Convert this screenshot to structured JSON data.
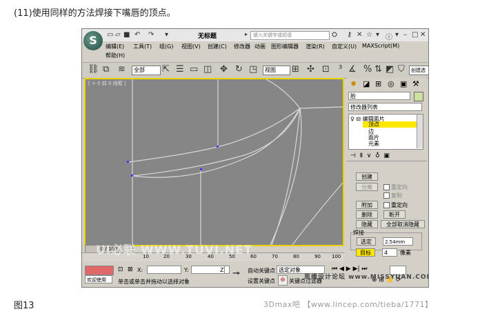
{
  "caption": "(11)使用同样的方法焊接下嘴唇的顶点。",
  "figure_label": "图13",
  "footer_credit": "3Dmax吧 【www.lincep.com/tieba/1771】",
  "app": {
    "logo": "S",
    "title": "无标题",
    "search_placeholder": "键入关键字或短语",
    "menus": [
      "编辑(E)",
      "工具(T)",
      "组(G)",
      "视图(V)",
      "创建(C)",
      "修改器",
      "动画",
      "图形编辑器",
      "渲染(R)",
      "自定义(U)",
      "MAXScript(M)",
      "帮助(H)"
    ],
    "toolbar": {
      "selection_filter": "全部",
      "ref_coord": "视图",
      "named_sel": "创建选"
    },
    "viewport_label": "[ + 0 前 0 线框 ]",
    "command_panel": {
      "object_name": "脸",
      "modifier_list": "修改器列表",
      "stack": [
        {
          "label": "编辑面片",
          "indent": 0,
          "selected": false
        },
        {
          "label": "顶点",
          "indent": 1,
          "selected": true
        },
        {
          "label": "边",
          "indent": 1,
          "selected": false
        },
        {
          "label": "面片",
          "indent": 1,
          "selected": false
        },
        {
          "label": "元素",
          "indent": 1,
          "selected": false
        }
      ],
      "buttons": {
        "create": "创建",
        "detach": "分离",
        "reorient": "重定向",
        "copy": "复制",
        "attach": "附加",
        "reorient2": "重定向",
        "delete": "删除",
        "break": "断开",
        "hide": "隐藏",
        "unhide_all": "全部取消隐藏"
      },
      "weld_group": {
        "title": "焊接",
        "selected_btn": "选定",
        "value": "2.54mm",
        "target_btn": "目标",
        "target_value": "4",
        "pixel_label": "像素"
      }
    },
    "timeline": {
      "frame": "0 / 100",
      "ticks": [
        "10",
        "20",
        "30",
        "40",
        "50",
        "60",
        "70",
        "80",
        "90",
        "100"
      ]
    },
    "status": {
      "script_label": "欢迎使用",
      "msg": "单击或单击并拖动以选择对象",
      "x_label": "X:",
      "y_label": "Y:",
      "z_label": "Z:",
      "auto_key": "自动关键点",
      "set_key": "设置关键点",
      "selected_object": "选定对象",
      "key_filters": "关键点过滤器"
    }
  },
  "watermarks": {
    "left": "UI必联 WWW.TUVI.NET",
    "right": "思缘设计论坛 www.MISSYUAN.COM"
  }
}
